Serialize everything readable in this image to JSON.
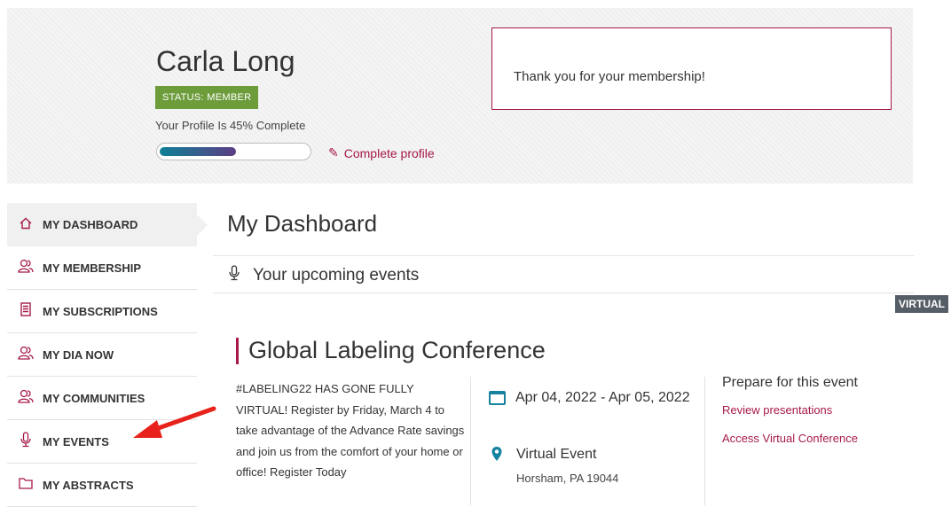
{
  "profile": {
    "name": "Carla Long",
    "status": "STATUS: MEMBER",
    "completion_text": "Your Profile Is 45% Complete",
    "completion_percent": 45,
    "complete_link": "Complete profile",
    "message": "Thank you for your membership!"
  },
  "sidebar": {
    "items": [
      {
        "label": "MY DASHBOARD",
        "icon": "home-icon",
        "active": true
      },
      {
        "label": "MY MEMBERSHIP",
        "icon": "users-icon",
        "active": false
      },
      {
        "label": "MY SUBSCRIPTIONS",
        "icon": "document-icon",
        "active": false
      },
      {
        "label": "MY DIA NOW",
        "icon": "users-icon",
        "active": false
      },
      {
        "label": "MY COMMUNITIES",
        "icon": "users-icon",
        "active": false
      },
      {
        "label": "MY EVENTS",
        "icon": "microphone-icon",
        "active": false
      },
      {
        "label": "MY ABSTRACTS",
        "icon": "folder-icon",
        "active": false
      }
    ]
  },
  "main": {
    "title": "My Dashboard",
    "upcoming_title": "Your upcoming events",
    "event": {
      "tag": "VIRTUAL",
      "title": "Global Labeling Conference",
      "description": "#LABELING22 HAS GONE FULLY VIRTUAL! Register by Friday, March 4 to take advantage of the Advance Rate savings and join us from the comfort of your home or office! Register Today",
      "date": "Apr 04, 2022 - Apr 05, 2022",
      "location_name": "Virtual Event",
      "location_address": "Horsham, PA 19044",
      "prepare_title": "Prepare for this event",
      "links": [
        "Review presentations",
        "Access Virtual Conference"
      ]
    }
  },
  "colors": {
    "accent": "#a6194a",
    "status_green": "#6d9c3b",
    "teal": "#1582a0",
    "annotation_red": "#e8221b"
  }
}
